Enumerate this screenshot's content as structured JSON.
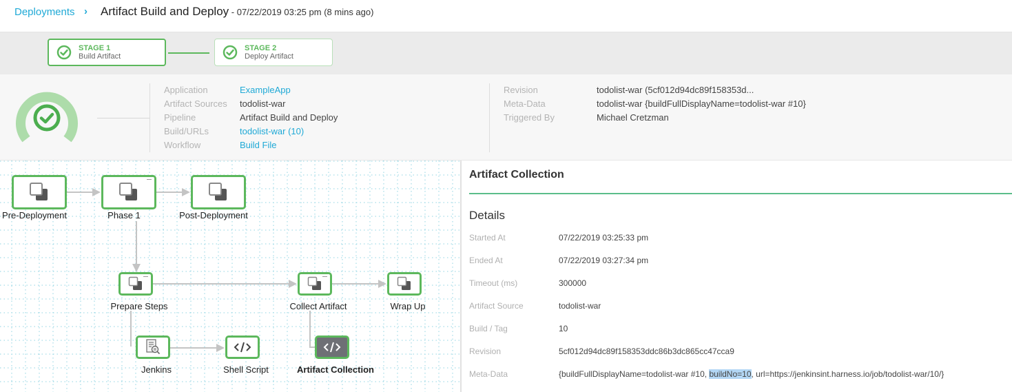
{
  "header": {
    "breadcrumb_link": "Deployments",
    "breadcrumb_separator": "›",
    "title": "Artifact Build and Deploy",
    "subtitle": " - 07/22/2019 03:25 pm (8 mins ago)"
  },
  "stages": [
    {
      "name": "STAGE 1",
      "description": "Build Artifact",
      "status": "success"
    },
    {
      "name": "STAGE 2",
      "description": "Deploy Artifact",
      "status": "success"
    }
  ],
  "summary": {
    "status_icon": "success-check-icon",
    "left": [
      {
        "label": "Application",
        "value": "ExampleApp",
        "link": true
      },
      {
        "label": "Artifact Sources",
        "value": "todolist-war",
        "link": false
      },
      {
        "label": "Pipeline",
        "value": "Artifact Build and Deploy",
        "link": false
      },
      {
        "label": "Build/URLs",
        "value": "todolist-war (10)",
        "link": true
      },
      {
        "label": "Workflow",
        "value": "Build File",
        "link": true
      }
    ],
    "right": [
      {
        "label": "Revision",
        "value": "todolist-war (5cf012d94dc89f158353d..."
      },
      {
        "label": "Meta-Data",
        "value": "todolist-war {buildFullDisplayName=todolist-war #10}"
      },
      {
        "label": "Triggered By",
        "value": "Michael Cretzman"
      }
    ]
  },
  "graph": {
    "nodes": [
      {
        "id": "pre-deployment",
        "label": "Pre-Deployment",
        "icon": "phase-icon",
        "selected": false
      },
      {
        "id": "phase-1",
        "label": "Phase 1",
        "icon": "phase-icon",
        "selected": false
      },
      {
        "id": "post-deployment",
        "label": "Post-Deployment",
        "icon": "phase-icon",
        "selected": false
      },
      {
        "id": "prepare-steps",
        "label": "Prepare Steps",
        "icon": "phase-icon",
        "selected": false
      },
      {
        "id": "collect-artifact",
        "label": "Collect Artifact",
        "icon": "phase-icon",
        "selected": false
      },
      {
        "id": "wrap-up",
        "label": "Wrap Up",
        "icon": "phase-icon",
        "selected": false
      },
      {
        "id": "jenkins",
        "label": "Jenkins",
        "icon": "jenkins-document-search-icon",
        "selected": false
      },
      {
        "id": "shell-script",
        "label": "Shell Script",
        "icon": "code-icon",
        "selected": false
      },
      {
        "id": "artifact-collection",
        "label": "Artifact Collection",
        "icon": "code-icon",
        "selected": true
      }
    ]
  },
  "panel": {
    "title": "Artifact Collection",
    "section": "Details",
    "rows": [
      {
        "label": "Started At",
        "value": "07/22/2019 03:25:33 pm"
      },
      {
        "label": "Ended At",
        "value": "07/22/2019 03:27:34 pm"
      },
      {
        "label": "Timeout (ms)",
        "value": "300000"
      },
      {
        "label": "Artifact Source",
        "value": "todolist-war"
      },
      {
        "label": "Build / Tag",
        "value": "10"
      },
      {
        "label": "Revision",
        "value": "5cf012d94dc89f158353ddc86b3dc865cc47cca9"
      }
    ],
    "metadata": {
      "label": "Meta-Data",
      "before": "{buildFullDisplayName=todolist-war #10, ",
      "highlighted": "buildNo=10",
      "after": ", url=https://jenkinsint.harness.io/job/todolist-war/10/}"
    }
  },
  "colors": {
    "accent_blue": "#1fa9d6",
    "success_green": "#5cb85c",
    "selected_node": "#6e7075"
  }
}
